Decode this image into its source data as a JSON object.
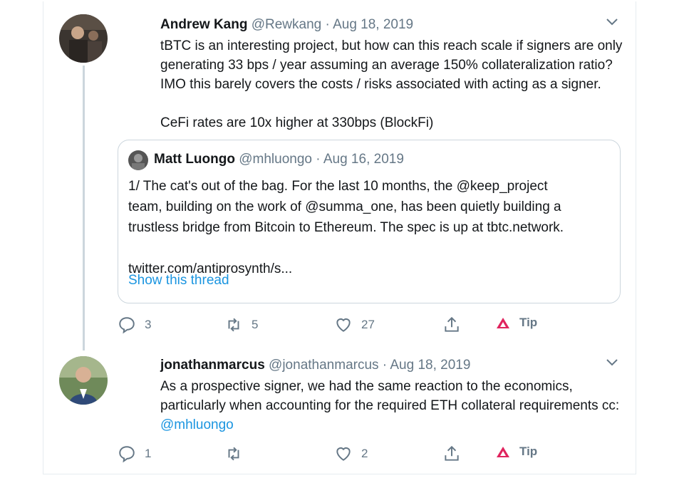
{
  "tweets": [
    {
      "name": "Andrew Kang",
      "handle": "@Rewkang",
      "sep": " · ",
      "date": "Aug 18, 2019",
      "text": "tBTC is an interesting project, but how can this reach scale if signers are only\ngenerating 33 bps / year assuming an average 150% collateralization ratio?\nIMO this barely covers the costs / risks associated with acting as a signer.\n\nCeFi rates are 10x higher at 330bps (BlockFi)",
      "quote": {
        "name": "Matt Luongo",
        "handle": "@mhluongo",
        "sep": " · ",
        "date": "Aug 16, 2019",
        "text": "1/ The cat's out of the bag. For the last 10 months, the @keep_project\n team, building on the work of @summa_one, has been quietly building a\ntrustless bridge from Bitcoin to Ethereum. The spec is up at tbtc.network.\n\ntwitter.com/antiprosynth/s...",
        "show_thread": "Show this thread"
      },
      "replies": "3",
      "retweets": "5",
      "likes": "27",
      "tip": "Tip"
    },
    {
      "name": "jonathanmarcus",
      "handle": "@jonathanmarcus",
      "sep": " · ",
      "date": "Aug 18, 2019",
      "text": "As a prospective signer, we had the same reaction to the economics,\nparticularly when accounting for the required ETH collateral requirements cc:",
      "mention": "@mhluongo",
      "replies": "1",
      "retweets": "",
      "likes": "2",
      "tip": "Tip"
    }
  ],
  "colors": {
    "link": "#1b95e0",
    "muted": "#657786",
    "tip": "#e0245e",
    "border": "#ccd6dd"
  },
  "icons": [
    "chevron-down-icon",
    "reply-icon",
    "retweet-icon",
    "like-icon",
    "share-icon",
    "tip-icon"
  ]
}
